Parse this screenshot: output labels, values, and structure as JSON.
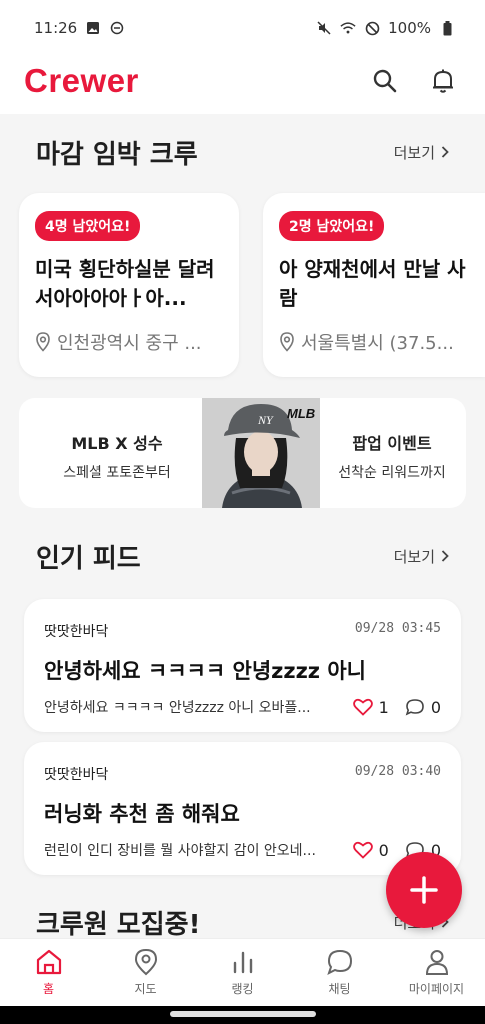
{
  "status_bar": {
    "time": "11:26",
    "battery": "100%"
  },
  "app": {
    "brand": "Crewer",
    "accent_color": "#e8193c"
  },
  "sections": {
    "deadline": {
      "title": "마감 임박 크루",
      "more": "더보기"
    },
    "feed": {
      "title": "인기 피드",
      "more": "더보기"
    },
    "recruit": {
      "title": "크루원 모집중!",
      "more": "더보기"
    }
  },
  "deadline_cards": [
    {
      "badge": "4명 남았어요!",
      "title": "미국 횡단하실분 달려서아아아아ㅏ아...",
      "location": "인천광역시 중구 ..."
    },
    {
      "badge": "2명 남았어요!",
      "title": "아 양재천에서 만날 사람",
      "location": "서울특별시 (37.5..."
    }
  ],
  "banner": {
    "left_title": "MLB X 성수",
    "left_sub": "스페셜 포토존부터",
    "right_title": "팝업 이벤트",
    "right_sub": "선착순 리워드까지",
    "brand_tag": "MLB"
  },
  "feeds": [
    {
      "author": "땃땃한바닥",
      "date": "09/28 03:45",
      "title": "안녕하세요 ㅋㅋㅋㅋ 안녕zzzz 아니",
      "preview": "안녕하세요 ㅋㅋㅋㅋ 안녕zzzz 아니 오바플...",
      "likes": "1",
      "comments": "0"
    },
    {
      "author": "땃땃한바닥",
      "date": "09/28 03:40",
      "title": "러닝화 추천 좀 해줘요",
      "preview": "런린이 인디 장비를 뭘 사야할지 감이 안오네...",
      "likes": "0",
      "comments": "0"
    }
  ],
  "bottom_nav": [
    {
      "label": "홈",
      "icon": "home-icon",
      "active": true
    },
    {
      "label": "지도",
      "icon": "map-pin-icon",
      "active": false
    },
    {
      "label": "랭킹",
      "icon": "bar-chart-icon",
      "active": false
    },
    {
      "label": "채팅",
      "icon": "chat-icon",
      "active": false
    },
    {
      "label": "마이페이지",
      "icon": "person-icon",
      "active": false
    }
  ]
}
